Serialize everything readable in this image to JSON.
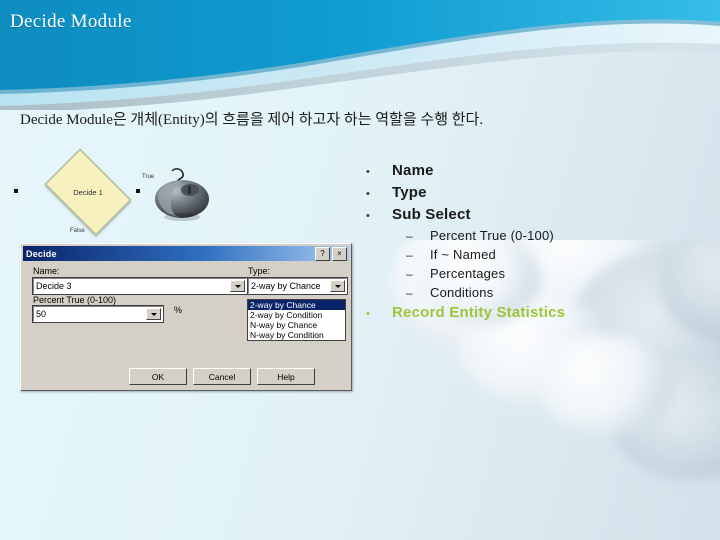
{
  "slide": {
    "title": "Decide Module",
    "intro": "Decide Module은 개체(Entity)의 흐름을 제어 하고자 하는 역할을 수행 한다.",
    "colors": {
      "header_blue": "#0f9bd0",
      "header_blue_dark": "#0d86b8",
      "header_light": "#9fd9ea",
      "background": "#e4f6fa",
      "accent_green": "#9dc53b",
      "dialog_face": "#d4d0c8",
      "titlebar_blue": "#0a246a"
    }
  },
  "diagram": {
    "shape_label": "Decide 1",
    "true_label": "True",
    "false_label": "False"
  },
  "dialog": {
    "title": "Decide",
    "help_button": "?",
    "close_button": "×",
    "name_label": "Name:",
    "name_value": "Decide 3",
    "type_label": "Type:",
    "type_value": "2-way by Chance",
    "type_options": [
      "2-way by Chance",
      "2-way by Condition",
      "N-way by Chance",
      "N-way by Condition"
    ],
    "percent_label": "Percent True (0-100)",
    "percent_value": "50",
    "percent_sign": "%",
    "ok_label": "OK",
    "cancel_label": "Cancel",
    "help_label": "Help"
  },
  "bullets": {
    "marker_level1": "•",
    "marker_level2": "–",
    "level1": [
      {
        "label": "Name"
      },
      {
        "label": "Type"
      },
      {
        "label": "Sub Select"
      }
    ],
    "level2": [
      {
        "label": "Percent True (0-100)"
      },
      {
        "label": "If ~ Named"
      },
      {
        "label": "Percentages"
      },
      {
        "label": "Conditions"
      }
    ],
    "last": {
      "label": "Record Entity Statistics"
    }
  }
}
